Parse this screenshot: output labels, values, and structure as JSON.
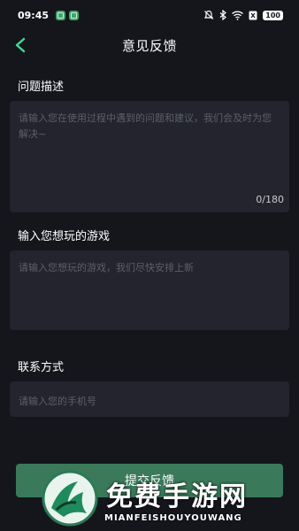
{
  "status_bar": {
    "time": "09:45",
    "battery": "100",
    "icons": [
      "app-icon",
      "app-icon",
      "mute-icon",
      "bluetooth-icon",
      "wifi-icon",
      "sim-icon",
      "battery-icon"
    ]
  },
  "header": {
    "title": "意见反馈",
    "back_icon": "chevron-left-icon",
    "accent_color": "#3ddc97"
  },
  "form": {
    "problem": {
      "label": "问题描述",
      "placeholder": "请输入您在使用过程中遇到的问题和建议，我们会及时为您解决~",
      "counter": "0/180"
    },
    "game": {
      "label": "输入您想玩的游戏",
      "placeholder": "请输入您想玩的游戏，我们尽快安排上新"
    },
    "contact": {
      "label": "联系方式",
      "placeholder": "请输入您的手机号"
    },
    "submit_label": "提交反馈"
  },
  "watermark": {
    "title": "免费手游网",
    "subtitle": "MIANFEISHOUYOUWANG"
  }
}
